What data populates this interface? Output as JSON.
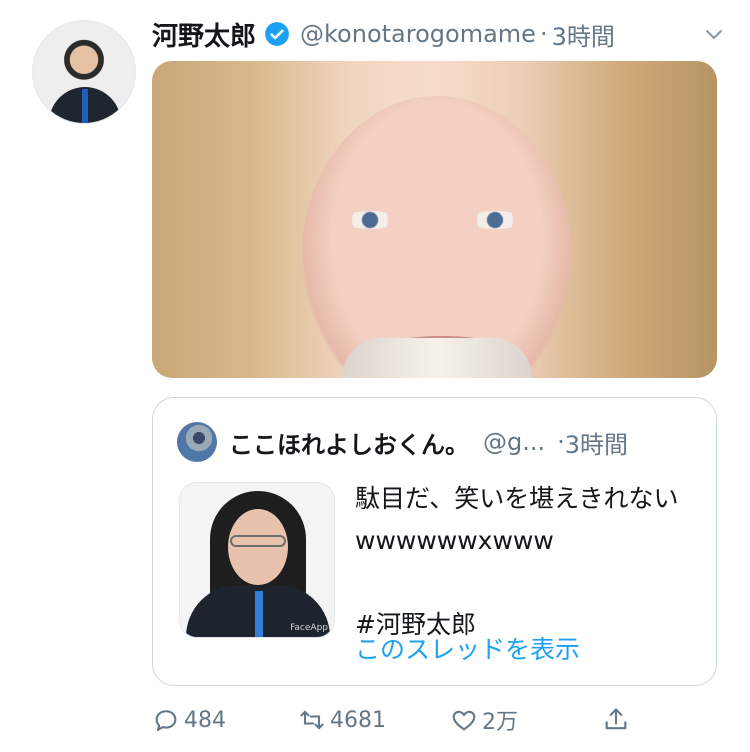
{
  "tweet": {
    "author_name": "河野太郎",
    "verified_icon": "verified-badge-icon",
    "handle": "@konotarogomame",
    "dot": "·",
    "time": "3時間"
  },
  "quote": {
    "author_name": "ここほれよしおくん。",
    "handle": "@g...",
    "dot": "·",
    "time": "3時間",
    "text": "駄目だ、笑いを堪えきれないwwwwwwxwww\n\n#河野太郎",
    "link": "このスレッドを表示",
    "image_watermark": "FaceApp"
  },
  "actions": {
    "reply_count": "484",
    "retweet_count": "4681",
    "like_count": "2万"
  },
  "colors": {
    "accent": "#1da1f2",
    "secondary_text": "#657786",
    "border": "#ccd6dd"
  }
}
